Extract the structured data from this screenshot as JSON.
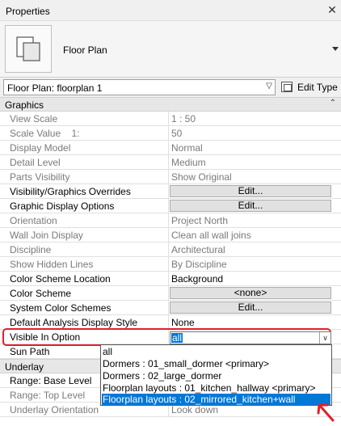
{
  "panel": {
    "title": "Properties",
    "close_glyph": "✕",
    "type_name": "Floor Plan",
    "selector_value": "Floor Plan: floorplan 1",
    "edit_type_label": "Edit Type"
  },
  "groups": {
    "graphics": "Graphics",
    "underlay": "Underlay"
  },
  "rows": {
    "view_scale": {
      "name": "View Scale",
      "value": "1 : 50"
    },
    "scale_value": {
      "name": "Scale Value    1:",
      "value": "50"
    },
    "display_model": {
      "name": "Display Model",
      "value": "Normal"
    },
    "detail_level": {
      "name": "Detail Level",
      "value": "Medium"
    },
    "parts_visibility": {
      "name": "Parts Visibility",
      "value": "Show Original"
    },
    "vg_overrides": {
      "name": "Visibility/Graphics Overrides",
      "value": "Edit..."
    },
    "graphic_display": {
      "name": "Graphic Display Options",
      "value": "Edit..."
    },
    "orientation": {
      "name": "Orientation",
      "value": "Project North"
    },
    "wall_join": {
      "name": "Wall Join Display",
      "value": "Clean all wall joins"
    },
    "discipline": {
      "name": "Discipline",
      "value": "Architectural"
    },
    "hidden_lines": {
      "name": "Show Hidden Lines",
      "value": "By Discipline"
    },
    "color_scheme_location": {
      "name": "Color Scheme Location",
      "value": "Background"
    },
    "color_scheme": {
      "name": "Color Scheme",
      "value": "<none>"
    },
    "system_color_schemes": {
      "name": "System Color Schemes",
      "value": "Edit..."
    },
    "default_analysis": {
      "name": "Default Analysis Display Style",
      "value": "None"
    },
    "visible_in_option": {
      "name": "Visible In Option",
      "value": "all"
    },
    "sun_path": {
      "name": "Sun Path"
    },
    "range_base": {
      "name": "Range: Base Level"
    },
    "range_top": {
      "name": "Range: Top Level"
    },
    "underlay_orientation": {
      "name": "Underlay Orientation",
      "value": "Look down"
    }
  },
  "dropdown": {
    "options": [
      "all",
      "Dormers : 01_small_dormer  <primary>",
      "Dormers : 02_large_dormer",
      "Floorplan layouts : 01_kitchen_hallway  <primary>",
      "Floorplan layouts : 02_mirrored_kitchen+wall"
    ],
    "highlighted": "Floorplan layouts : 02_mirrored_kitchen+wall"
  },
  "colors": {
    "selection": "#0078d7",
    "annotation": "#e2202a",
    "readonly_text": "#7a7a7a"
  },
  "icons": {
    "type_thumbnail": "floor-plan-icon",
    "edit_type": "edit-type-icon",
    "close": "close-icon",
    "collapse": "chevron-up-icon"
  }
}
